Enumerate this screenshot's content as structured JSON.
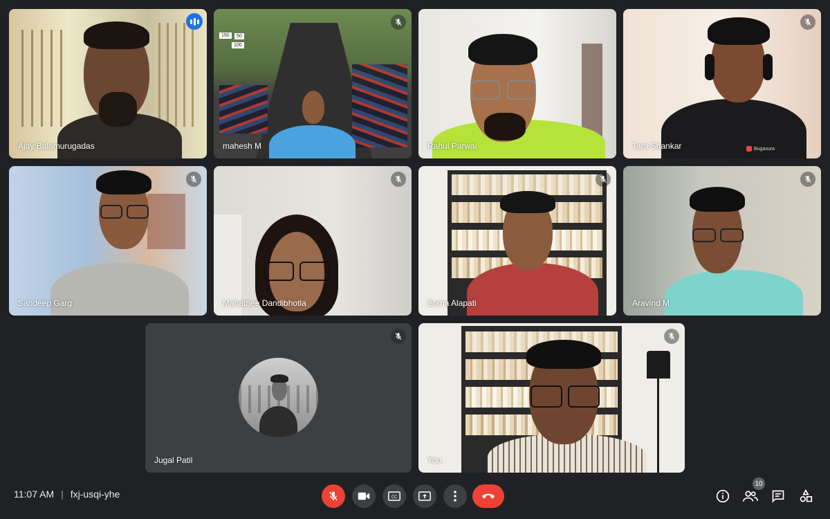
{
  "meeting": {
    "time": "11:07 AM",
    "separator": "|",
    "code": "fxj-usqi-yhe"
  },
  "participants": [
    {
      "name": "Ajay Balamurugadas",
      "speaking": true
    },
    {
      "name": "mahesh M",
      "muted": true
    },
    {
      "name": "Rahul Parwal"
    },
    {
      "name": "Tara Shankar",
      "muted": true,
      "shirt_logo": "Bugasura"
    },
    {
      "name": "Sandeep Garg",
      "muted": true
    },
    {
      "name": "Mahathee Dandibhotla",
      "muted": true
    },
    {
      "name": "Soma Alapati",
      "muted": true
    },
    {
      "name": "Aravind M.",
      "muted": true
    },
    {
      "name": "Jugal Patil",
      "muted": true
    },
    {
      "name": "You",
      "muted": true
    }
  ],
  "track_signs": [
    "50",
    "100",
    "150"
  ],
  "controls": {
    "mic": "mic-off-icon",
    "camera": "camera-icon",
    "captions": "captions-icon",
    "present": "present-icon",
    "more": "more-vert-icon",
    "hangup": "call-end-icon"
  },
  "side": {
    "people_count": "10"
  },
  "colors": {
    "speaking_border": "#8ab4f8",
    "hangup": "#ea4335",
    "background": "#202124"
  }
}
